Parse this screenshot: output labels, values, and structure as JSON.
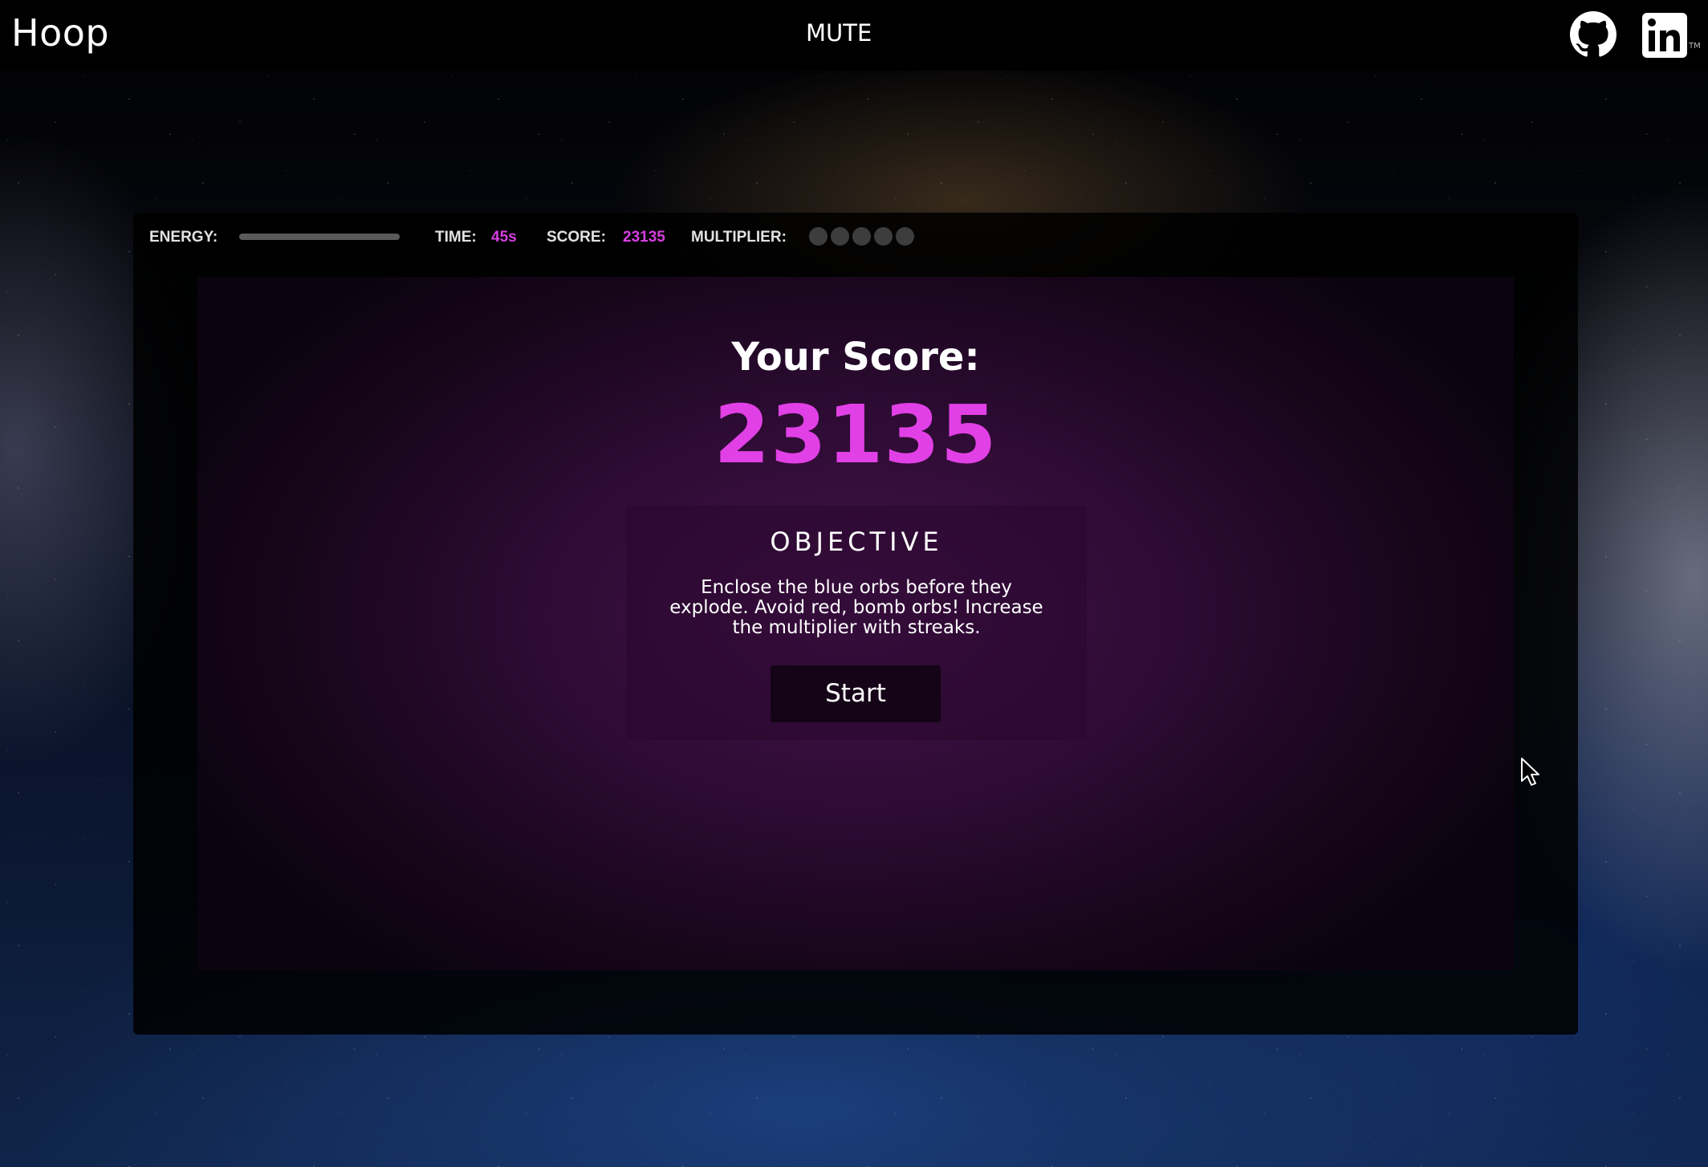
{
  "header": {
    "brand": "Hoop",
    "mute_label": "MUTE",
    "github_icon": "github-icon",
    "linkedin_icon": "linkedin-icon",
    "linkedin_tm": "TM"
  },
  "hud": {
    "energy_label": "ENERGY:",
    "energy_level": 0,
    "time_label": "TIME:",
    "time_value": "45s",
    "score_label": "SCORE:",
    "score_value": "23135",
    "multiplier_label": "MULTIPLIER:",
    "multiplier_dots": 5,
    "multiplier_active": 0
  },
  "results": {
    "score_title": "Your Score:",
    "score_value": "23135"
  },
  "objective": {
    "title": "OBJECTIVE",
    "text": "Enclose the blue orbs before they explode. Avoid red, bomb orbs! Increase the multiplier with streaks.",
    "start_label": "Start"
  },
  "colors": {
    "accent": "#e140e6",
    "panel": "#000000",
    "arena": "#2d0b33"
  }
}
